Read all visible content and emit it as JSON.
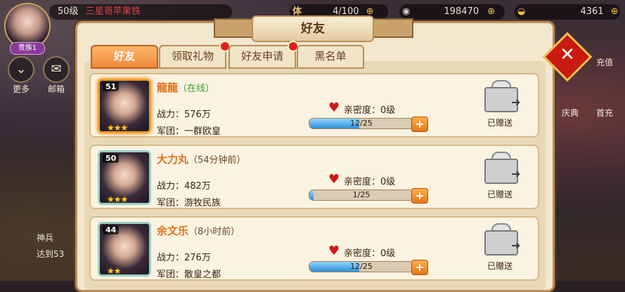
{
  "hud": {
    "level_text": "50级",
    "player_name": "三星哥苹果铁",
    "vip": "贵族1",
    "stamina_label": "体",
    "stamina": "4/100",
    "silver": "198470",
    "gold": "4361"
  },
  "left_menu": [
    {
      "label": "更多"
    },
    {
      "label": "邮箱"
    }
  ],
  "left_bottom": {
    "line1": "神兵",
    "line2": "达到53"
  },
  "right_menu": [
    {
      "label": "充值"
    },
    {
      "label": "庆典"
    },
    {
      "label": "首充"
    }
  ],
  "panel": {
    "title": "好友"
  },
  "tabs": [
    {
      "label": "好友",
      "active": true,
      "badge": false
    },
    {
      "label": "领取礼物",
      "active": false,
      "badge": true
    },
    {
      "label": "好友申请",
      "active": false,
      "badge": true
    },
    {
      "label": "黑名单",
      "active": false,
      "badge": false
    }
  ],
  "friends": [
    {
      "level": "51",
      "name": "龍龍",
      "status": "（在线）",
      "online": true,
      "power": "战力：576万",
      "guild": "军团：一群欧皇",
      "intimacy": "亲密度：0级",
      "progress": "12/25",
      "progress_value": 0.48,
      "sent": "已赠送"
    },
    {
      "level": "50",
      "name": "大力丸",
      "status": "（54分钟前）",
      "online": false,
      "power": "战力：482万",
      "guild": "军团：游牧民族",
      "intimacy": "亲密度：0级",
      "progress": "1/25",
      "progress_value": 0.04,
      "sent": "已赠送"
    },
    {
      "level": "44",
      "name": "余文乐",
      "status": "（8小时前）",
      "online": false,
      "power": "战力：276万",
      "guild": "军团：散皇之都",
      "intimacy": "亲密度：0级",
      "progress": "12/25",
      "progress_value": 0.48,
      "sent": "已赠送"
    }
  ],
  "colors": {
    "accent": "#f08a3a",
    "progress": "#2f8fd8",
    "close": "#c81a10"
  }
}
